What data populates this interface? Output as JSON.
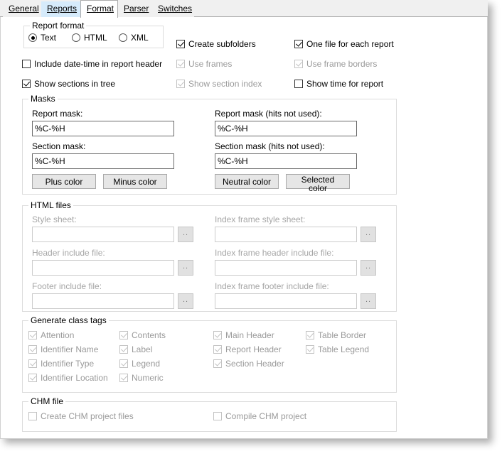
{
  "window": {
    "tabs": [
      {
        "id": "general",
        "label": "General",
        "accel": "G",
        "state": "inactive"
      },
      {
        "id": "reports",
        "label": "Reports",
        "accel": "R",
        "state": "hover"
      },
      {
        "id": "format",
        "label": "Format",
        "accel": "F",
        "state": "active"
      },
      {
        "id": "parser",
        "label": "Parser",
        "accel": "P",
        "state": "inactive"
      },
      {
        "id": "switches",
        "label": "Switches",
        "accel": "S",
        "state": "inactive"
      }
    ]
  },
  "report_format": {
    "title": "Report format",
    "options": [
      {
        "label": "Text",
        "selected": true
      },
      {
        "label": "HTML",
        "selected": false
      },
      {
        "label": "XML",
        "selected": false
      }
    ]
  },
  "top_options": {
    "include_datetime": {
      "label": "Include date-time in report header",
      "checked": false,
      "enabled": true
    },
    "show_sections_tree": {
      "label": "Show sections in tree",
      "checked": true,
      "enabled": true
    },
    "create_subfolders": {
      "label": "Create subfolders",
      "checked": true,
      "enabled": true
    },
    "use_frames": {
      "label": "Use frames",
      "checked": true,
      "enabled": false
    },
    "show_section_index": {
      "label": "Show section index",
      "checked": true,
      "enabled": false
    },
    "one_file_each_report": {
      "label": "One file for each report",
      "checked": true,
      "enabled": true
    },
    "use_frame_borders": {
      "label": "Use frame borders",
      "checked": true,
      "enabled": false
    },
    "show_time_for_report": {
      "label": "Show time for report",
      "checked": false,
      "enabled": true
    }
  },
  "masks": {
    "title": "Masks",
    "report_mask": {
      "label": "Report mask:",
      "value": "%C-%H"
    },
    "report_mask_hits": {
      "label": "Report mask (hits not used):",
      "value": "%C-%H"
    },
    "section_mask": {
      "label": "Section mask:",
      "value": "%C-%H"
    },
    "section_mask_hits": {
      "label": "Section mask (hits not used):",
      "value": "%C-%H"
    },
    "buttons": {
      "plus": "Plus color",
      "minus": "Minus color",
      "neutral": "Neutral color",
      "selected": "Selected color"
    }
  },
  "html_files": {
    "title": "HTML files",
    "browse_label": "..",
    "fields": [
      {
        "id": "style-sheet",
        "label": "Style sheet:",
        "value": ""
      },
      {
        "id": "index-frame-style-sheet",
        "label": "Index frame style sheet:",
        "value": ""
      },
      {
        "id": "header-include-file",
        "label": "Header include file:",
        "value": ""
      },
      {
        "id": "index-frame-header-include",
        "label": "Index frame header include file:",
        "value": ""
      },
      {
        "id": "footer-include-file",
        "label": "Footer include file:",
        "value": ""
      },
      {
        "id": "index-frame-footer-include",
        "label": "Index frame footer include file:",
        "value": ""
      }
    ]
  },
  "class_tags": {
    "title": "Generate class tags",
    "col1": [
      {
        "label": "Attention",
        "checked": true,
        "enabled": false
      },
      {
        "label": "Identifier Name",
        "checked": true,
        "enabled": false
      },
      {
        "label": "Identifier Type",
        "checked": true,
        "enabled": false
      },
      {
        "label": "Identifier Location",
        "checked": true,
        "enabled": false
      }
    ],
    "col2": [
      {
        "label": "Contents",
        "checked": true,
        "enabled": false
      },
      {
        "label": "Label",
        "checked": true,
        "enabled": false
      },
      {
        "label": "Legend",
        "checked": true,
        "enabled": false
      },
      {
        "label": "Numeric",
        "checked": true,
        "enabled": false
      }
    ],
    "col3": [
      {
        "label": "Main Header",
        "checked": true,
        "enabled": false
      },
      {
        "label": "Report Header",
        "checked": true,
        "enabled": false
      },
      {
        "label": "Section Header",
        "checked": true,
        "enabled": false
      }
    ],
    "col4": [
      {
        "label": "Table Border",
        "checked": true,
        "enabled": false
      },
      {
        "label": "Table Legend",
        "checked": true,
        "enabled": false
      }
    ]
  },
  "chm": {
    "title": "CHM file",
    "create": {
      "label": "Create CHM project files",
      "checked": false,
      "enabled": false
    },
    "compile": {
      "label": "Compile CHM project",
      "checked": false,
      "enabled": false
    }
  },
  "colors": {
    "tab_hover": "#d6ebfb",
    "page_bg": "#ffffff",
    "strip_bg": "#f0f0f0",
    "group_border": "#dcdcdc",
    "disabled_text": "#a6a6a6",
    "button_face": "#e6e6e6"
  }
}
